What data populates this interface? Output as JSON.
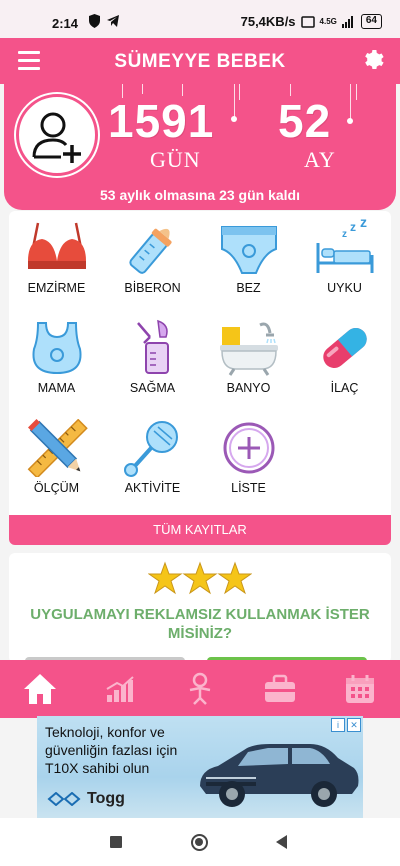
{
  "status_bar": {
    "time": "2:14",
    "speed": "75,4KB/s",
    "network": "4.5G",
    "battery": "64"
  },
  "app_bar": {
    "title": "SÜMEYYE BEBEK",
    "menu_icon": "hamburger-menu-icon",
    "settings_icon": "gear-icon"
  },
  "header": {
    "days_value": "1591",
    "days_label": "GÜN",
    "months_value": "52",
    "months_label": "AY",
    "remaining_text": "53 aylık olmasına 23 gün kaldı",
    "avatar_icon": "add-user-icon"
  },
  "grid": {
    "items": [
      {
        "label": "EMZİRME",
        "icon": "bra-icon"
      },
      {
        "label": "BİBERON",
        "icon": "baby-bottle-icon"
      },
      {
        "label": "BEZ",
        "icon": "diaper-icon"
      },
      {
        "label": "UYKU",
        "icon": "sleep-bed-icon"
      },
      {
        "label": "MAMA",
        "icon": "bib-icon"
      },
      {
        "label": "SAĞMA",
        "icon": "breast-pump-icon"
      },
      {
        "label": "BANYO",
        "icon": "bathtub-icon"
      },
      {
        "label": "İLAÇ",
        "icon": "pill-icon"
      },
      {
        "label": "ÖLÇÜM",
        "icon": "ruler-pencil-icon"
      },
      {
        "label": "AKTİVİTE",
        "icon": "rattle-icon"
      },
      {
        "label": "LİSTE",
        "icon": "add-circle-icon"
      }
    ],
    "all_records_label": "TÜM KAYITLAR"
  },
  "promo": {
    "question": "UYGULAMAYI REKLAMSIZ KULLANMAK İSTER MİSİNİZ?",
    "stars_icon": "gold-stars-icon"
  },
  "bottom_nav": [
    {
      "icon": "home-icon"
    },
    {
      "icon": "growth-chart-icon"
    },
    {
      "icon": "baby-icon"
    },
    {
      "icon": "medical-bag-icon"
    },
    {
      "icon": "calendar-icon"
    }
  ],
  "ad": {
    "text": "Teknoloji, konfor ve güvenliğin fazlası için T10X sahibi olun",
    "brand": "Togg",
    "image": "suv-car-image"
  },
  "colors": {
    "primary": "#f4538a",
    "promo_text": "#6dae6b"
  }
}
